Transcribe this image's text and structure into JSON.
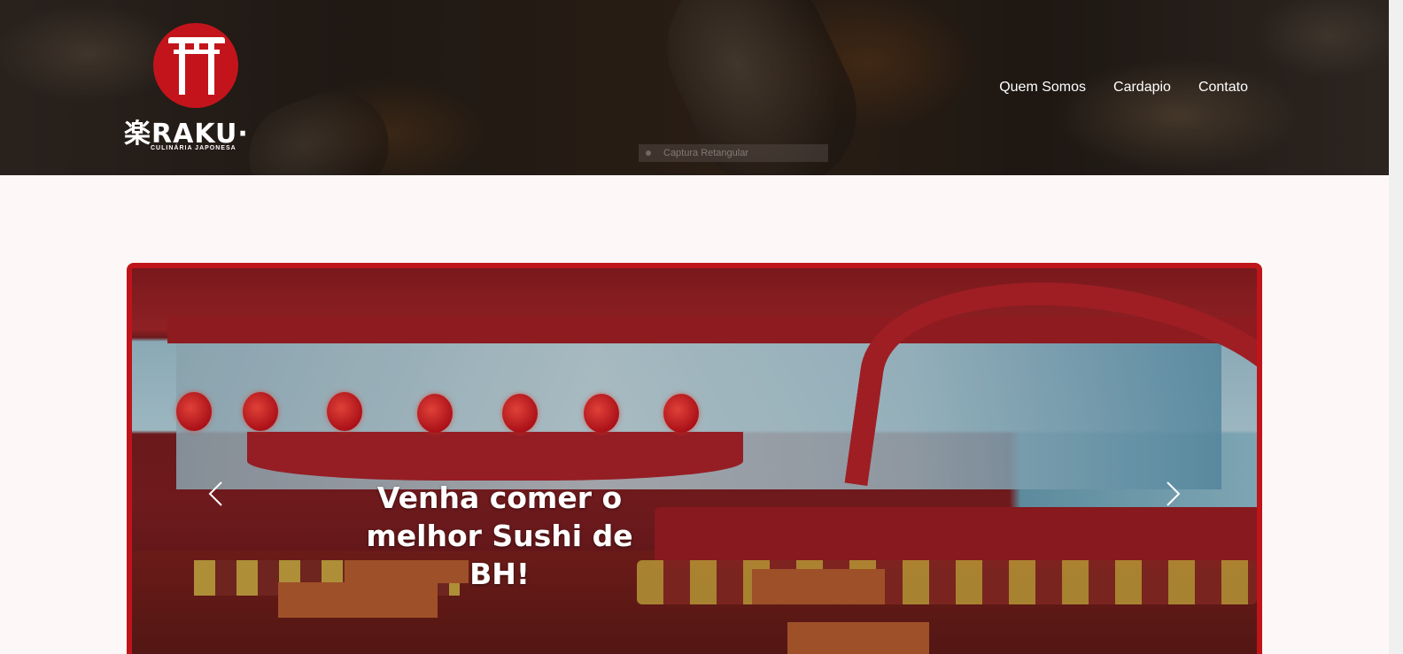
{
  "header": {
    "logo": {
      "brand": "楽RAKU·",
      "subtitle": "CULINÁRIA JAPONESA",
      "icon": "torii-gate-icon"
    },
    "nav": [
      {
        "label": "Quem Somos"
      },
      {
        "label": "Cardapio"
      },
      {
        "label": "Contato"
      }
    ],
    "capture_overlay": {
      "label": "Captura Retangular"
    }
  },
  "carousel": {
    "caption": "Venha comer o melhor Sushi de BH!",
    "prev_icon": "chevron-left-icon",
    "next_icon": "chevron-right-icon",
    "border_color": "#c0141b"
  },
  "colors": {
    "accent": "#c3141c",
    "background": "#fdf8f7"
  }
}
